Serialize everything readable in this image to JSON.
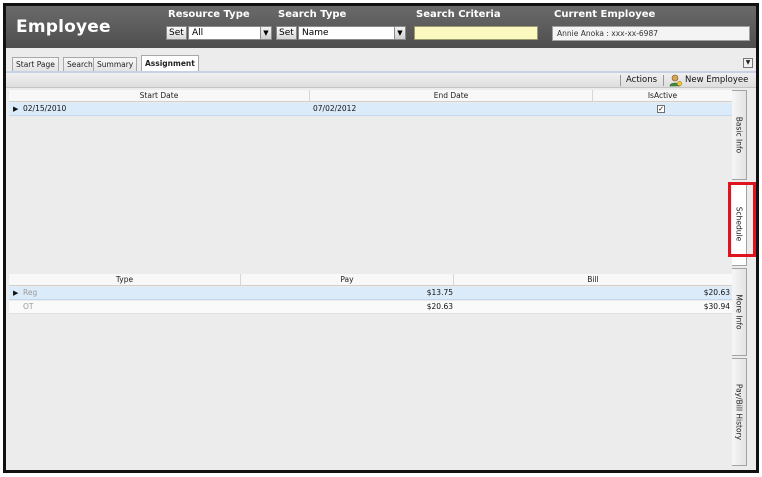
{
  "header": {
    "title": "Employee",
    "resource_type_label": "Resource Type",
    "search_type_label": "Search Type",
    "search_criteria_label": "Search Criteria",
    "current_employee_label": "Current Employee",
    "set_label": "Set",
    "resource_type_value": "All",
    "search_type_value": "Name",
    "search_criteria_value": "",
    "current_employee_value": "Annie  Anoka : xxx-xx-6987"
  },
  "tabs": [
    {
      "label": "Start Page"
    },
    {
      "label": "Search"
    },
    {
      "label": "Summary"
    },
    {
      "label": "Assignment"
    }
  ],
  "actions": {
    "actions_label": "Actions",
    "new_employee_label": "New Employee"
  },
  "assignment_grid": {
    "columns": [
      "Start Date",
      "End Date",
      "IsActive"
    ],
    "rows": [
      {
        "start_date": "02/15/2010",
        "end_date": "07/02/2012",
        "is_active": true
      }
    ]
  },
  "pay_grid": {
    "columns": [
      "Type",
      "Pay",
      "Bill"
    ],
    "rows": [
      {
        "type": "Reg",
        "pay": "$13.75",
        "bill": "$20.63"
      },
      {
        "type": "OT",
        "pay": "$20.63",
        "bill": "$30.94"
      }
    ]
  },
  "side_tabs": [
    {
      "label": "Basic Info"
    },
    {
      "label": "Schedule"
    },
    {
      "label": "More Info"
    },
    {
      "label": "Pay/Bill History"
    }
  ],
  "colors": {
    "header_bg": "#5a5a5a",
    "selected_row": "#dcebfa",
    "criteria_input": "#fbf8c0",
    "highlight": "#e0141e"
  }
}
